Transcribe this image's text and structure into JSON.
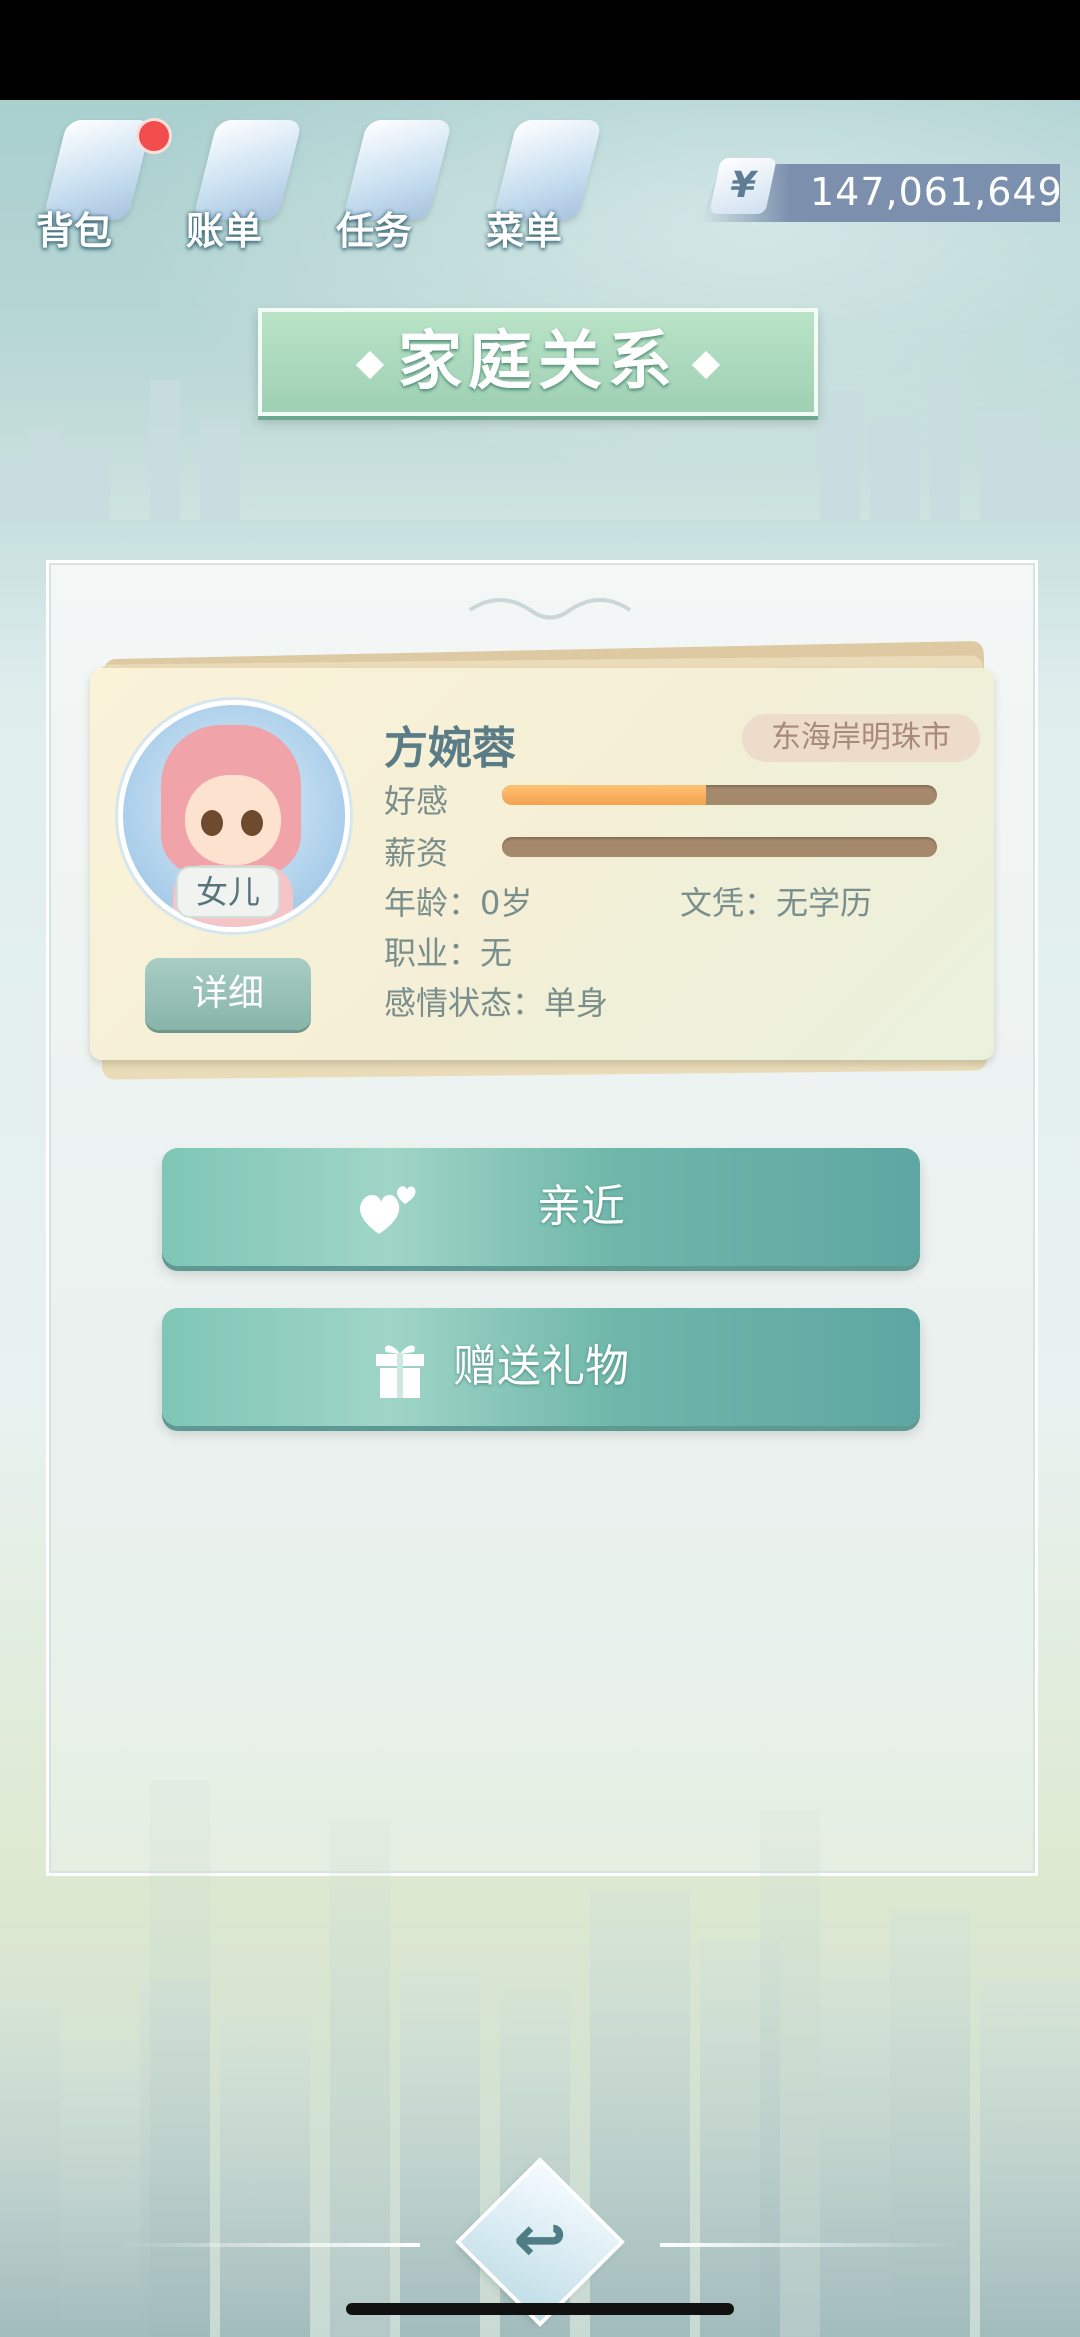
{
  "nav": {
    "items": [
      {
        "label": "背包"
      },
      {
        "label": "账单"
      },
      {
        "label": "任务"
      },
      {
        "label": "菜单"
      }
    ],
    "money_symbol": "¥",
    "money": "147,061,649"
  },
  "title": "家庭关系",
  "card": {
    "name": "方婉蓉",
    "city": "东海岸明珠市",
    "role": "女儿",
    "detail_label": "详细",
    "affection_label": "好感",
    "affection_fraction": 0.47,
    "salary_label": "薪资",
    "salary_fraction": 0.0,
    "age": "年龄：0岁",
    "education": "文凭：无学历",
    "job": "职业：无",
    "relationship": "感情状态：单身"
  },
  "actions": {
    "bond": "亲近",
    "gift": "赠送礼物"
  },
  "back_glyph": "↩",
  "colors": {
    "accent_green": "#9fd0b4",
    "button_teal": "#6fb7aa",
    "affection_fill": "#f4a24e",
    "bar_empty": "#a5896b",
    "badge_red": "#f24d4d"
  }
}
